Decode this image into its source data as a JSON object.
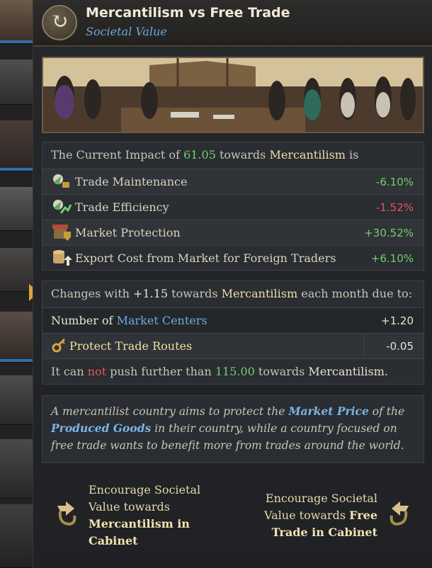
{
  "header": {
    "title": "Mercantilism vs Free Trade",
    "subtitle": "Societal Value",
    "icon": "cycle-arrows-icon"
  },
  "impact": {
    "intro_prefix": "The Current Impact of",
    "amount": "61.05",
    "towards": "towards",
    "target": "Mercantilism",
    "suffix": "is",
    "rows": [
      {
        "label": "Trade Maintenance",
        "value": "-6.10%",
        "icon": "trade-maintenance-icon",
        "color": "#6fd16b"
      },
      {
        "label": "Trade Efficiency",
        "value": "-1.52%",
        "icon": "trade-efficiency-icon",
        "color": "#e0575a"
      },
      {
        "label": "Market Protection",
        "value": "+30.52%",
        "icon": "market-protection-icon",
        "color": "#6fd16b"
      },
      {
        "label": "Export Cost from Market for Foreign Traders",
        "value": "+6.10%",
        "icon": "export-cost-icon",
        "color": "#6fd16b"
      }
    ]
  },
  "changes": {
    "prefix": "Changes with",
    "amount": "+1.15",
    "towards": "towards",
    "target": "Mercantilism",
    "suffix": "each month due to:",
    "rows": [
      {
        "label_prefix": "Number of",
        "label_link": "Market Centers",
        "value": "+1.20"
      },
      {
        "label": "Protect Trade Routes",
        "value": "-0.05",
        "icon": "privilege-key-icon"
      }
    ],
    "limit_prefix": "It can",
    "limit_not": "not",
    "limit_mid": "push further than",
    "limit_value": "115.00",
    "limit_towards": "towards",
    "limit_target": "Mercantilism."
  },
  "description": {
    "part1": "A mercantilist country aims to protect the",
    "link1": "Market Price",
    "part2": "of the",
    "link2": "Produced Goods",
    "part3": "in their country, while a country focused on free trade wants to benefit more from trades around the world."
  },
  "actions": {
    "left": {
      "line1": "Encourage Societal",
      "line2": "Value towards",
      "line3": "Mercantilism in",
      "line4": "Cabinet",
      "icon": "encourage-left-icon"
    },
    "right": {
      "line1": "Encourage Societal",
      "line2a": "Value towards",
      "line2b": "Free",
      "line3": "Trade in Cabinet",
      "icon": "encourage-right-icon"
    }
  },
  "colors": {
    "accent_blue": "#6fa8d8",
    "positive": "#6fd16b",
    "negative": "#e0575a",
    "gold": "#f0dfa6"
  }
}
